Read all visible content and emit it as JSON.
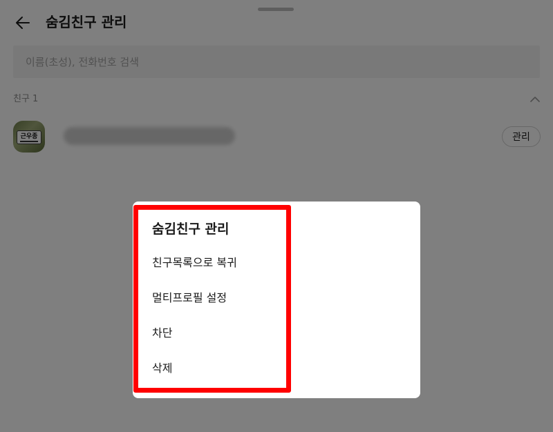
{
  "header": {
    "title": "숨김친구 관리",
    "back_icon": "arrow-left-icon"
  },
  "search": {
    "placeholder": "이름(초성), 전화번호 검색",
    "value": ""
  },
  "section": {
    "label": "친구 1",
    "toggle_icon": "chevron-up-icon"
  },
  "friend": {
    "avatar_text": "근우종",
    "manage_label": "관리"
  },
  "dialog": {
    "title": "숨김친구 관리",
    "items": [
      {
        "label": "친구목록으로 복귀"
      },
      {
        "label": "멀티프로필 설정"
      },
      {
        "label": "차단"
      },
      {
        "label": "삭제"
      }
    ]
  },
  "colors": {
    "highlight": "#ff0000",
    "overlay": "rgba(0,0,0,0.5)",
    "search_bg": "#f3f3f3"
  }
}
